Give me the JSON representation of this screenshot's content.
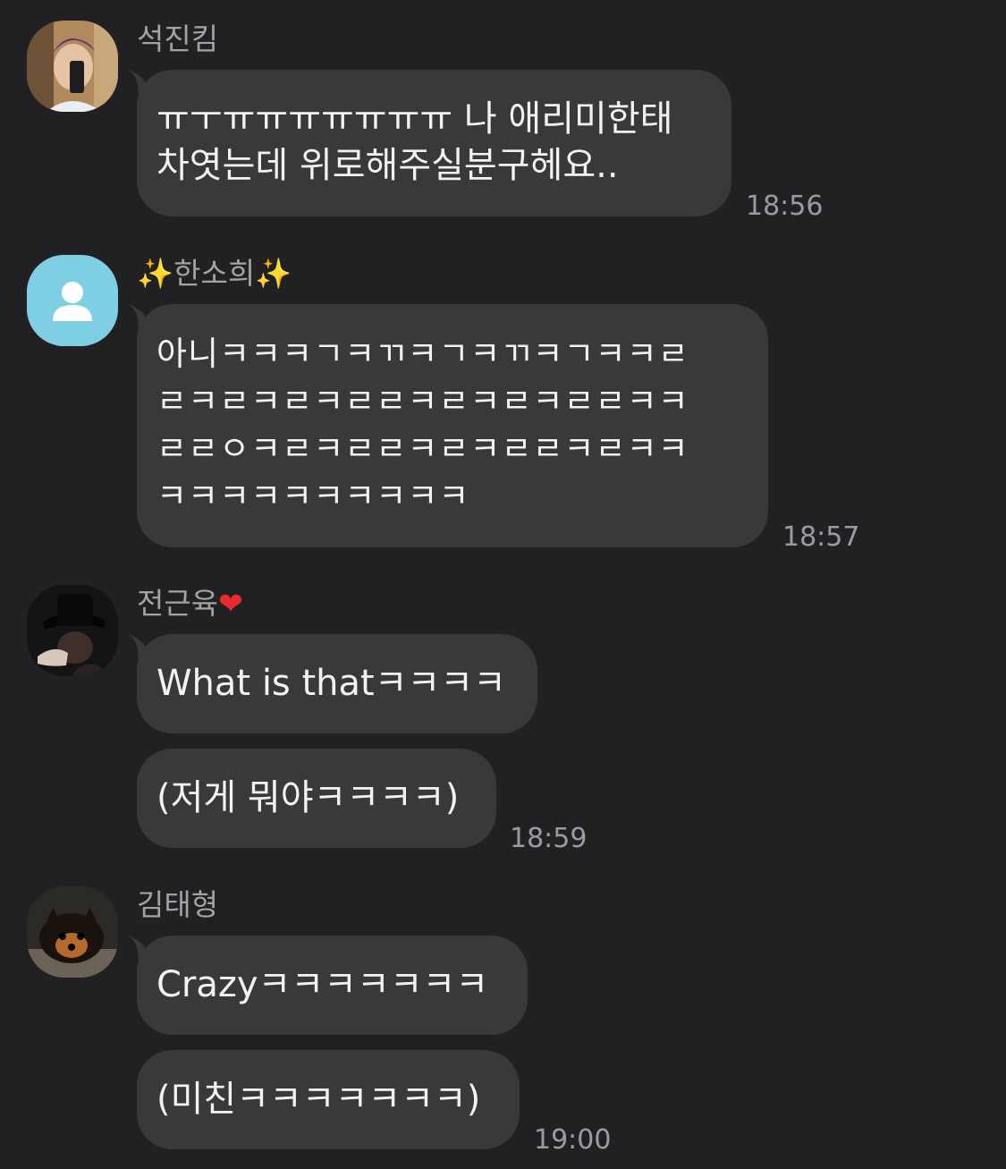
{
  "messages": [
    {
      "sender": "석진킴",
      "avatar": "selfie-photo",
      "bubbles": [
        "ㅠㅜㅠㅠㅠㅠㅠㅠㅠ 나 애리미한태\n차엿는데 위로해주실분구헤요.."
      ],
      "time": "18:56"
    },
    {
      "sender_prefix": "✨",
      "sender": "한소희",
      "sender_suffix": "✨",
      "avatar": "default-profile",
      "bubbles": [
        "아니ㅋㅋㅋㄱㅋㄲㅋㄱㅋㄲㅋㄱㅋㅋㄹ\nㄹㅋㄹㅋㄹㅋㄹㄹㅋㄹㅋㄹㅋㄹㄹㅋㅋ\nㄹㄹㅇㅋㄹㅋㄹㄹㅋㄹㅋㄹㄹㅋㄹㅋㅋ\nㅋㅋㅋㅋㅋㅋㅋㅋㅋㅋ"
      ],
      "time": "18:57"
    },
    {
      "sender": "전근육",
      "sender_suffix": "❤",
      "avatar": "dark-hat-photo",
      "bubbles": [
        "What is thatㅋㅋㅋㅋ",
        "(저게 뭐야ㅋㅋㅋㅋ)"
      ],
      "time": "18:59"
    },
    {
      "sender": "김태형",
      "avatar": "dog-photo",
      "bubbles": [
        "Crazyㅋㅋㅋㅋㅋㅋㅋ",
        "(미친ㅋㅋㅋㅋㅋㅋㅋ)"
      ],
      "time": "19:00"
    }
  ],
  "colors": {
    "background": "#212124",
    "bubble": "#39393c",
    "text": "#f2f2f2",
    "sender": "#a3a3a6",
    "time": "#9c9ca0",
    "default_avatar": "#7ecfe3"
  }
}
